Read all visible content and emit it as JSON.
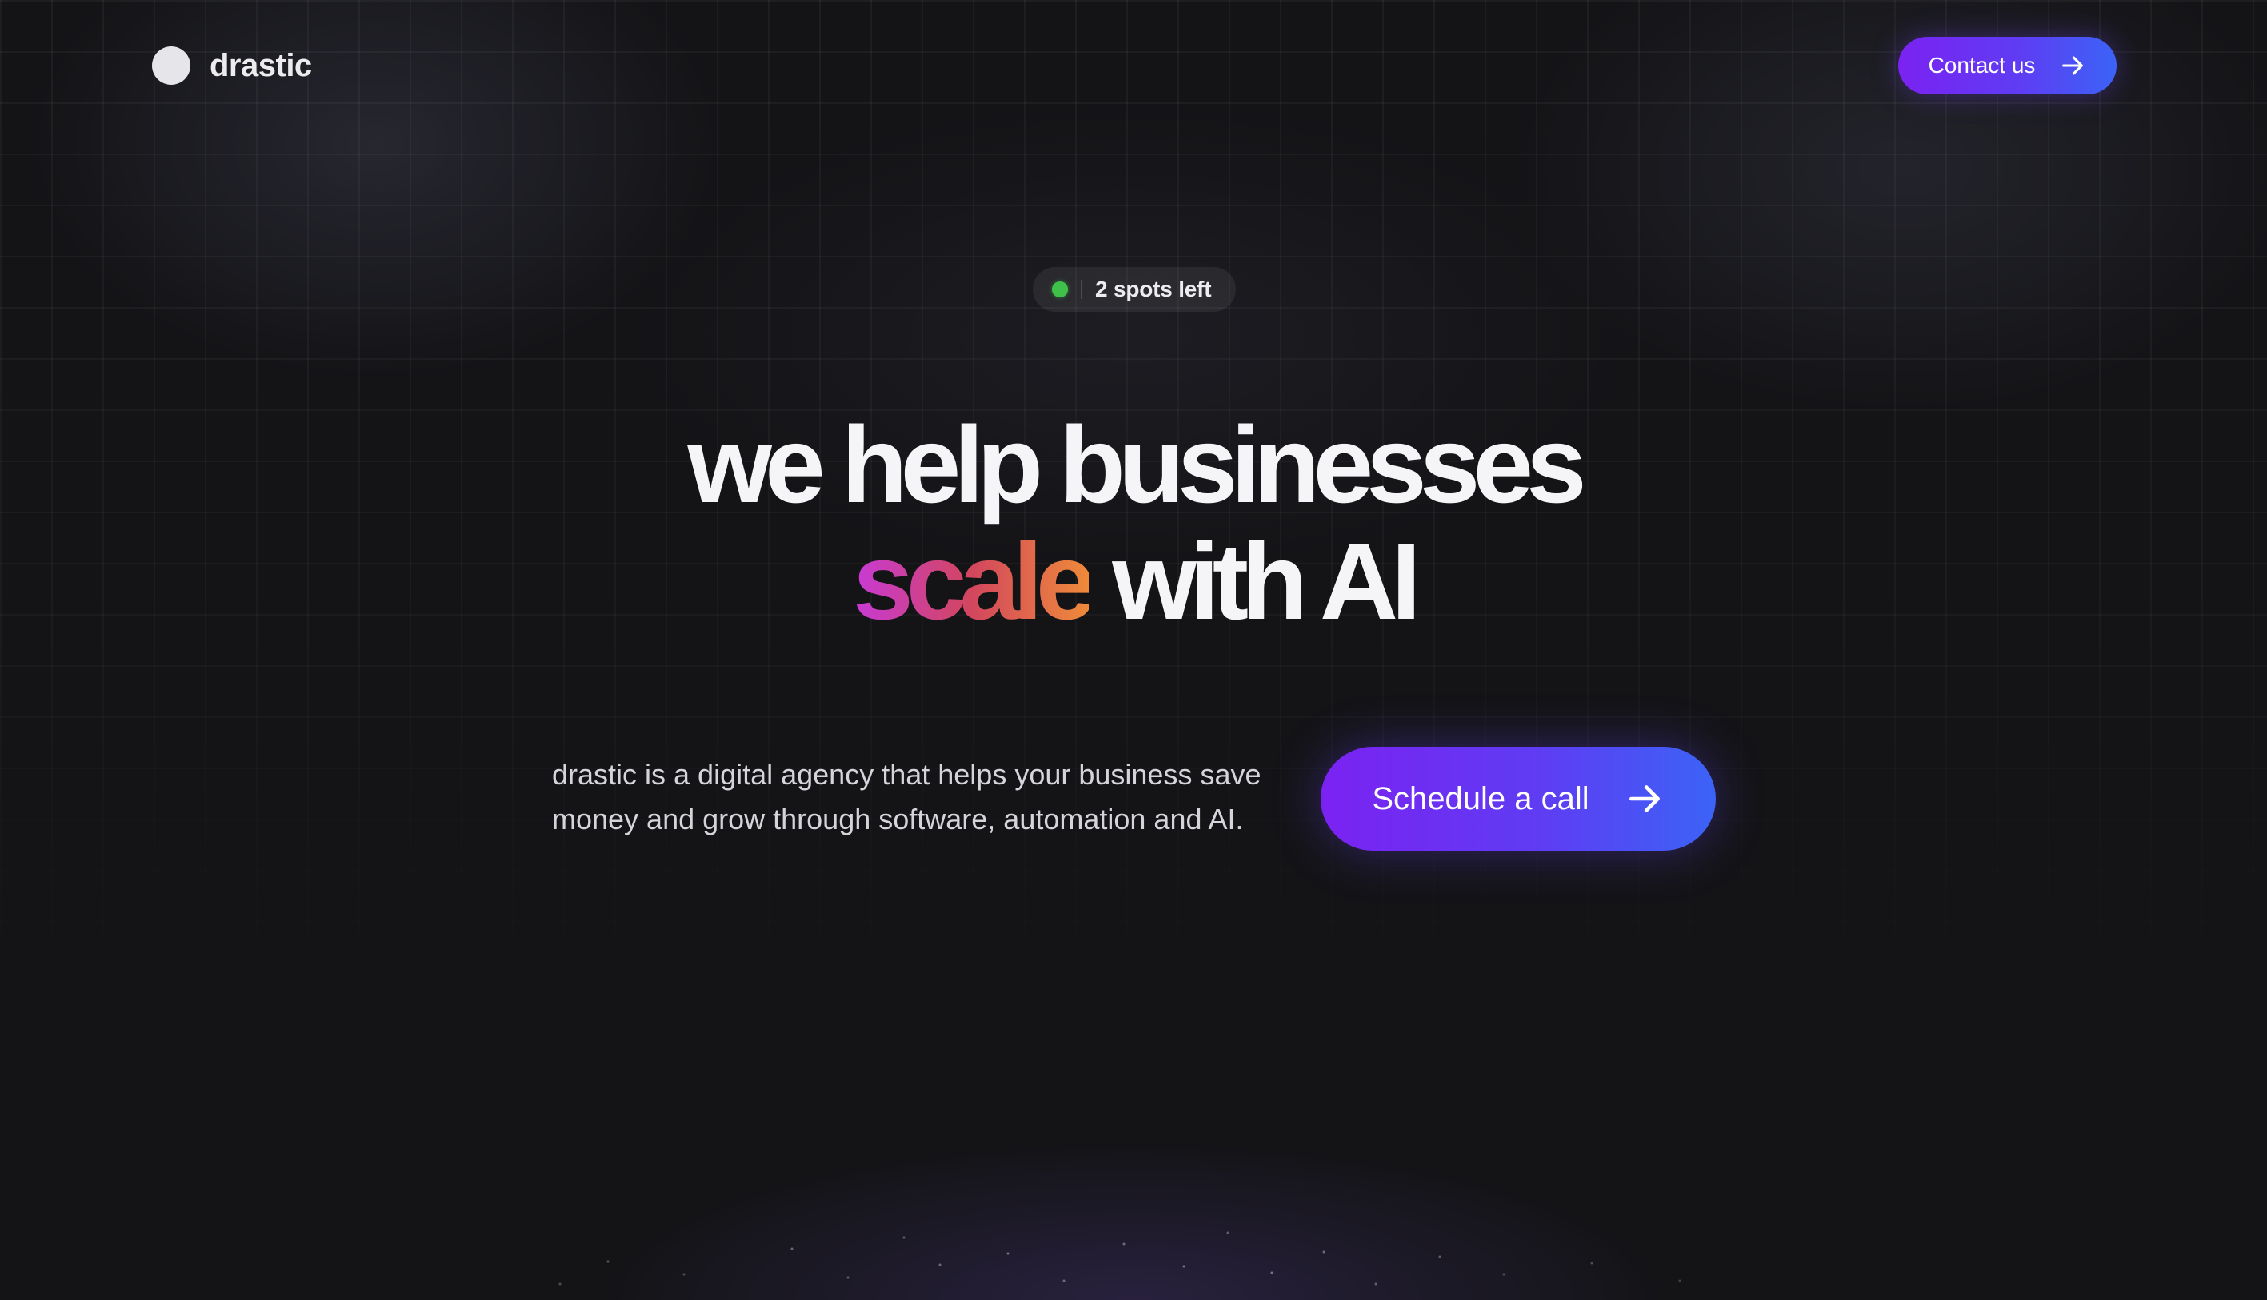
{
  "header": {
    "logo_text": "drastic",
    "contact_button_label": "Contact us",
    "contact_button_icon": "arrow-right-icon"
  },
  "badge": {
    "status_color": "#3fc24a",
    "text": "2 spots left"
  },
  "hero": {
    "line1": "we help businesses",
    "line2_highlight": "scale",
    "line2_rest": "with AI"
  },
  "description": {
    "line1": "drastic is a digital agency that helps your business save",
    "line2": "money and grow through software, automation and AI."
  },
  "cta": {
    "label": "Schedule a call",
    "icon": "arrow-right-icon"
  },
  "colors": {
    "background": "#141417",
    "button_gradient_start": "#7b22f2",
    "button_gradient_end": "#3b63f6",
    "highlight_gradient_start": "#c83ad6",
    "highlight_gradient_end": "#ee8a3a"
  }
}
